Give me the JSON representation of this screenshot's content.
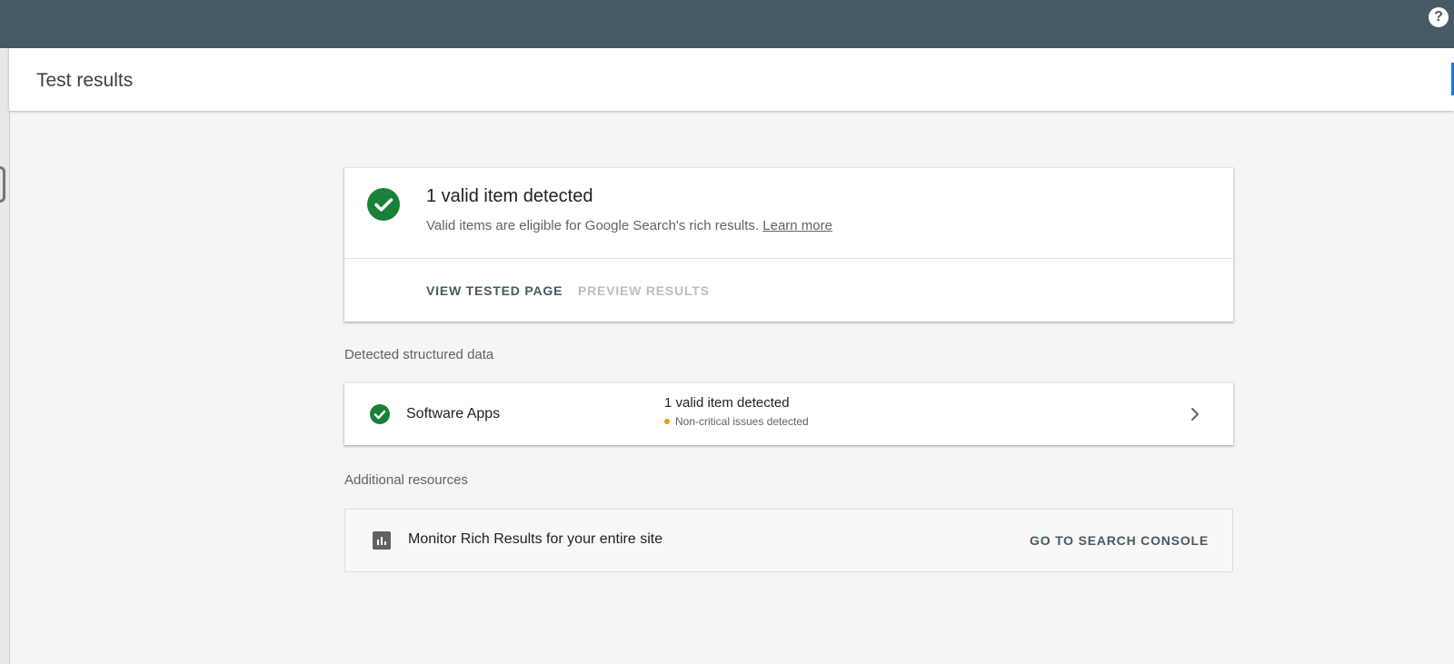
{
  "topbar": {
    "help_icon": "help-icon",
    "help_glyph": "?",
    "background": "#455a64"
  },
  "header": {
    "title": "Test results"
  },
  "summary": {
    "title": "1 valid item detected",
    "description": "Valid items are eligible for Google Search's rich results.",
    "learn_more": "Learn more",
    "actions": {
      "view_tested_page": "VIEW TESTED PAGE",
      "preview_results": "PREVIEW RESULTS"
    },
    "status_color": "#188038"
  },
  "detected": {
    "label": "Detected structured data",
    "items": [
      {
        "name": "Software Apps",
        "status": "1 valid item detected",
        "sub_status": "Non-critical issues detected",
        "warning_color": "#f29900"
      }
    ]
  },
  "resources": {
    "label": "Additional resources",
    "item_text": "Monitor Rich Results for your entire site",
    "button": "GO TO SEARCH CONSOLE"
  }
}
